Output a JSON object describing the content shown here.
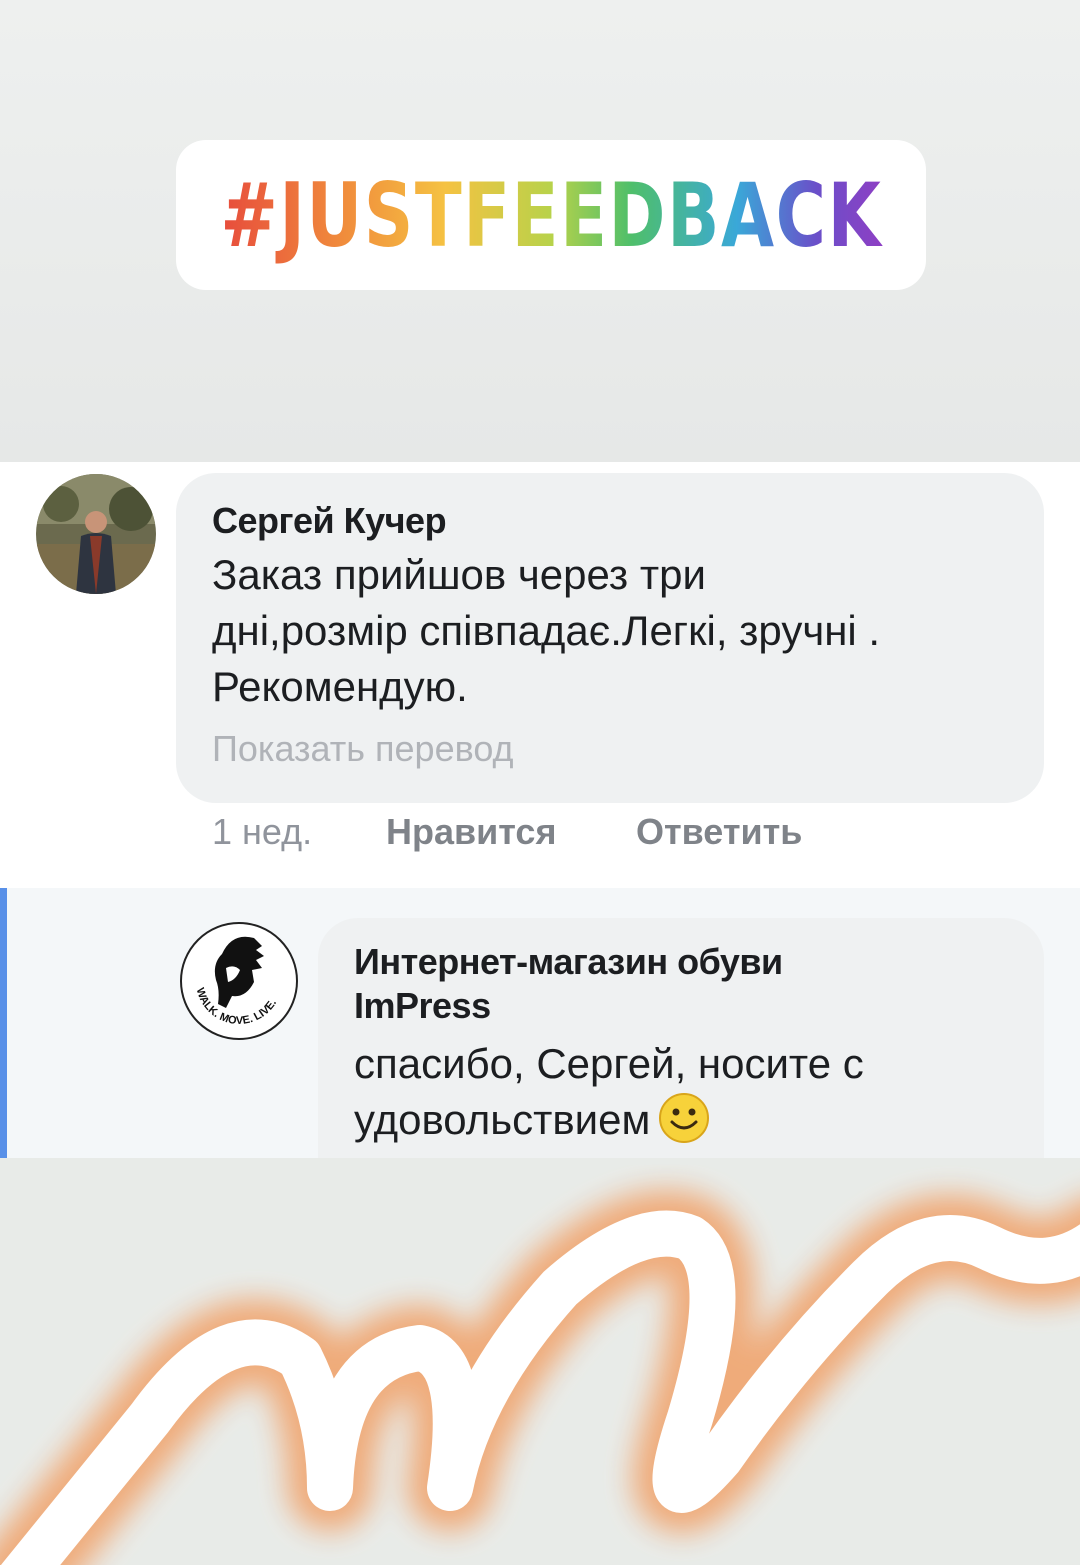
{
  "story": {
    "hashtag": "#JUSTFEEDBACK"
  },
  "comment": {
    "author": "Сергей Кучер",
    "text_line1": "Заказ прийшов через три",
    "text_line2": "дні,розмір співпадає.Легкі, зручні .",
    "text_line3": "Рекомендую.",
    "translate_link": "Показать перевод",
    "time": "1 нед.",
    "like_label": "Нравится",
    "reply_label": "Ответить"
  },
  "reply": {
    "author_line1": "Интернет-магазин обуви",
    "author_line2": "ImPress",
    "text_line1": "спасибо, Сергей, носите с",
    "text_line2": "удовольствием",
    "logo_text": "WALK. MOVE. LIVE.",
    "emoji": "smiley-emoji-icon"
  },
  "colors": {
    "bubble_bg": "#eff1f2",
    "reply_bar": "#5890e8",
    "brush_stroke": "#f0a874"
  }
}
